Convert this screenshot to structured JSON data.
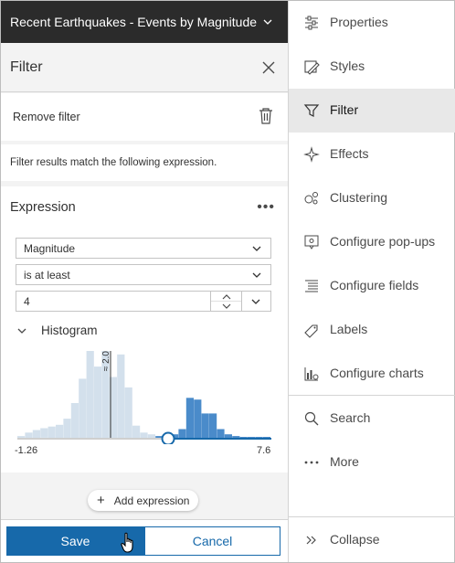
{
  "layer": {
    "title": "Recent Earthquakes - Events by Magnitude"
  },
  "filter_panel": {
    "title": "Filter",
    "remove_label": "Remove filter",
    "match_text": "Filter results match the following expression.",
    "expression": {
      "title": "Expression",
      "field": "Magnitude",
      "operator": "is at least",
      "value": "4",
      "histogram": {
        "title": "Histogram",
        "min_label": "-1.26",
        "max_label": "7.6",
        "marker_label": "≈ 2.0",
        "bins": [
          2,
          6,
          9,
          11,
          13,
          15,
          22,
          40,
          68,
          100,
          82,
          100,
          70,
          96,
          58,
          14,
          6,
          4,
          2,
          2,
          4,
          10,
          46,
          44,
          28,
          28,
          10,
          4,
          2,
          1,
          1,
          1,
          1
        ],
        "threshold_bin": 18,
        "handle_value": 4,
        "colors": {
          "unselected": "#d3e0ec",
          "selected": "#4a8bca",
          "track": "#1769aa",
          "track_off": "#cfcfcf"
        }
      }
    },
    "add_expression_label": "Add expression",
    "save_label": "Save",
    "cancel_label": "Cancel"
  },
  "rail": {
    "items": [
      {
        "label": "Properties",
        "icon": "sliders-icon"
      },
      {
        "label": "Styles",
        "icon": "styles-icon"
      },
      {
        "label": "Filter",
        "icon": "filter-icon",
        "active": true
      },
      {
        "label": "Effects",
        "icon": "sparkle-icon"
      },
      {
        "label": "Clustering",
        "icon": "clustering-icon"
      },
      {
        "label": "Configure pop-ups",
        "icon": "popup-icon"
      },
      {
        "label": "Configure fields",
        "icon": "fields-list-icon"
      },
      {
        "label": "Labels",
        "icon": "label-tag-icon"
      },
      {
        "label": "Configure charts",
        "icon": "charts-icon"
      },
      {
        "label": "Search",
        "icon": "search-icon"
      },
      {
        "label": "More",
        "icon": "more-dots-icon"
      }
    ],
    "collapse_label": "Collapse"
  },
  "colors": {
    "accent": "#1769aa",
    "header_bg": "#2b2b2b",
    "panel_bg": "#f3f3f3"
  }
}
